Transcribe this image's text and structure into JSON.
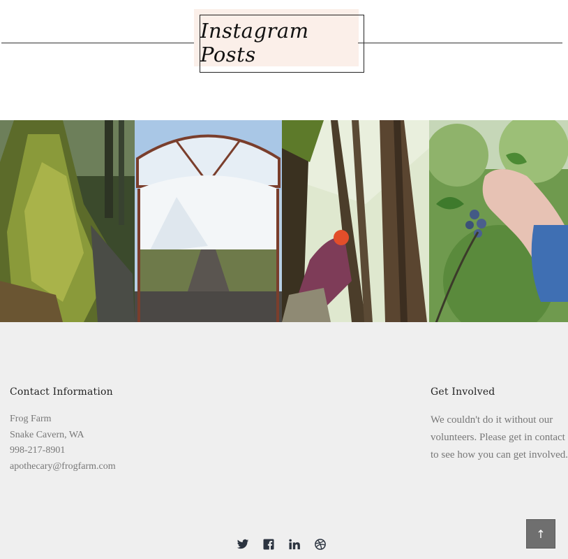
{
  "section": {
    "title": "Instagram Posts"
  },
  "gallery": {
    "photos": [
      {
        "subject": "mossy tree trunk"
      },
      {
        "subject": "greenhouse with seedlings"
      },
      {
        "subject": "forester among tall trees"
      },
      {
        "subject": "hand picking blueberries"
      }
    ]
  },
  "footer": {
    "contact": {
      "heading": "Contact Information",
      "lines": [
        "Frog Farm",
        "Snake Cavern, WA",
        "998-217-8901",
        "apothecary@frogfarm.com"
      ]
    },
    "involved": {
      "heading": "Get Involved",
      "text": "We couldn't do it without our volunteers. Please get in contact to see how you can get involved."
    },
    "social": [
      "twitter-icon",
      "facebook-icon",
      "linkedin-icon",
      "dribbble-icon"
    ],
    "back_to_top": {
      "glyph": "↑"
    }
  },
  "colors": {
    "title_highlight": "#fbefe9",
    "footer_bg": "#efefef",
    "muted_text": "#777777",
    "back_to_top_bg": "#6f6f6f"
  }
}
